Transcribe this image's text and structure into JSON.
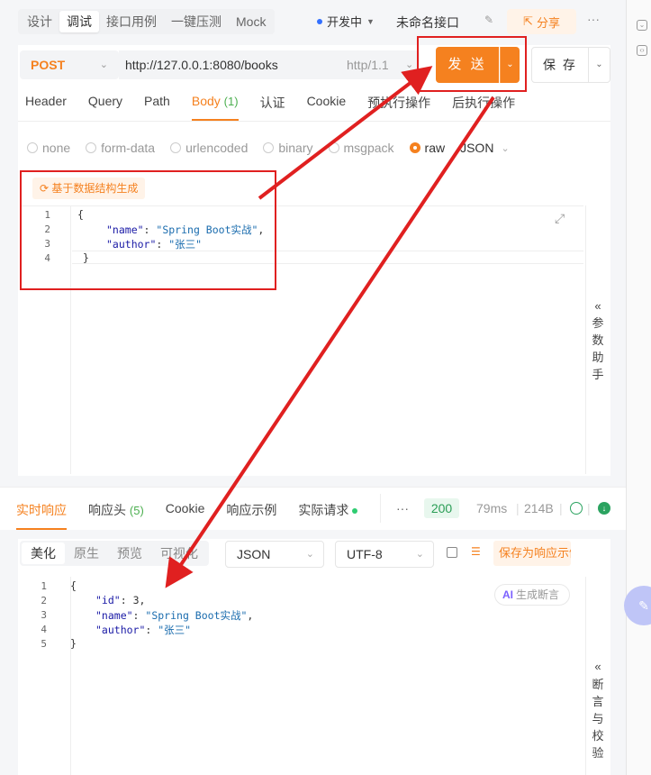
{
  "toolbar": {
    "tabs": [
      "设计",
      "调试",
      "接口用例",
      "一键压测",
      "Mock"
    ],
    "environment": "开发中",
    "api_name": "未命名接口",
    "share_label": "分享"
  },
  "request": {
    "method": "POST",
    "url": "http://127.0.0.1:8080/books",
    "http_version": "http/1.1",
    "send_label": "发 送",
    "save_label": "保 存",
    "tabs": [
      {
        "label": "Header",
        "count": ""
      },
      {
        "label": "Query",
        "count": ""
      },
      {
        "label": "Path",
        "count": ""
      },
      {
        "label": "Body",
        "count": "(1)"
      },
      {
        "label": "认证",
        "count": ""
      },
      {
        "label": "Cookie",
        "count": ""
      },
      {
        "label": "预执行操作",
        "count": ""
      },
      {
        "label": "后执行操作",
        "count": ""
      }
    ],
    "body_types": [
      "none",
      "form-data",
      "urlencoded",
      "binary",
      "msgpack",
      "raw"
    ],
    "selected_body_type": "raw",
    "content_type": "JSON",
    "generate_label": "基于数据结构生成",
    "body_lines": [
      "1",
      "2",
      "3",
      "4"
    ],
    "body_code": {
      "l1": "{",
      "l2_key": "\"name\"",
      "l2_val": "\"Spring Boot实战\"",
      "l3_key": "\"author\"",
      "l3_val": "\"张三\"",
      "l4": "}"
    },
    "assistant_label": [
      "«",
      "参",
      "数",
      "助",
      "手"
    ]
  },
  "response": {
    "tabs": [
      {
        "label": "实时响应",
        "count": ""
      },
      {
        "label": "响应头",
        "count": "(5)"
      },
      {
        "label": "Cookie",
        "count": ""
      },
      {
        "label": "响应示例",
        "count": ""
      },
      {
        "label": "实际请求",
        "count": ""
      }
    ],
    "more": "···",
    "status": "200",
    "time": "79ms",
    "size": "214B",
    "formats": [
      "美化",
      "原生",
      "预览",
      "可视化"
    ],
    "format": "JSON",
    "encoding": "UTF-8",
    "save_as_example": "保存为响应示例",
    "ai_label": "AI",
    "ai_text": "生成断言",
    "body_lines": [
      "1",
      "2",
      "3",
      "4",
      "5"
    ],
    "body_code": {
      "l1": "{",
      "l2_key": "\"id\"",
      "l2_val": "3",
      "l3_key": "\"name\"",
      "l3_val": "\"Spring Boot实战\"",
      "l4_key": "\"author\"",
      "l4_val": "\"张三\"",
      "l5": "}"
    },
    "assistant_label": [
      "«",
      "断",
      "言",
      "与",
      "校",
      "验"
    ]
  },
  "colors": {
    "accent": "#f5811f",
    "annotation": "#e02020",
    "success": "#2a9d55"
  }
}
